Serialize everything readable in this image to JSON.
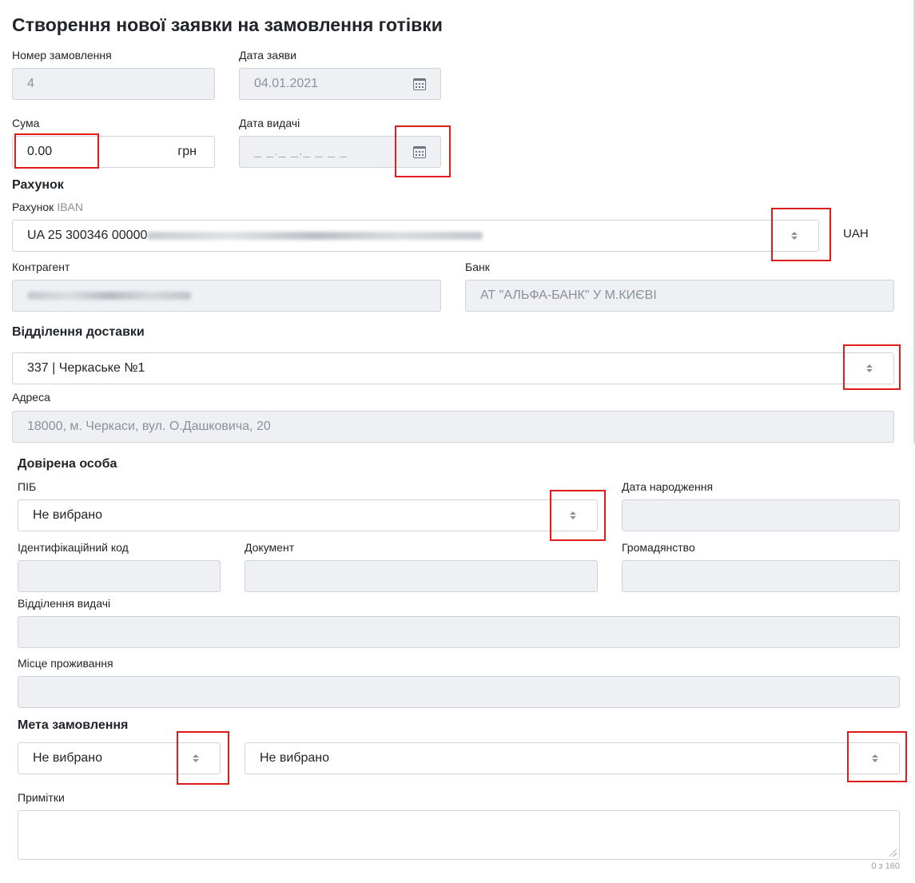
{
  "page": {
    "title": "Створення нової заявки на замовлення готівки"
  },
  "order": {
    "number_label": "Номер замовлення",
    "number_value": "4",
    "request_date_label": "Дата заяви",
    "request_date_value": "04.01.2021",
    "amount_label": "Сума",
    "amount_value": "0.00",
    "amount_currency": "грн",
    "issue_date_label": "Дата видачі",
    "issue_date_placeholder": "_ _._ _._ _ _ _"
  },
  "account": {
    "section_title": "Рахунок",
    "label": "Рахунок",
    "label_hint": "IBAN",
    "iban_visible": "UA 25 300346 00000",
    "currency": "UAH",
    "counterparty_label": "Контрагент",
    "bank_label": "Банк",
    "bank_value": "АТ \"АЛЬФА-БАНК\" У М.КИЄВІ"
  },
  "delivery": {
    "section_title": "Відділення доставки",
    "branch_value": "337 | Черкаське №1",
    "address_label": "Адреса",
    "address_value": "18000, м. Черкаси, вул. О.Дашковича, 20"
  },
  "trusted_person": {
    "section_title": "Довірена особа",
    "name_label": "ПІБ",
    "name_value": "Не вибрано",
    "birth_date_label": "Дата народження",
    "tax_id_label": "Ідентифікаційний код",
    "document_label": "Документ",
    "citizenship_label": "Громадянство",
    "issuing_office_label": "Відділення видачі",
    "residence_label": "Місце проживання"
  },
  "purpose": {
    "section_title": "Мета замовлення",
    "primary_value": "Не вибрано",
    "secondary_value": "Не вибрано"
  },
  "notes": {
    "label": "Примітки",
    "counter": "0 з 160"
  },
  "colors": {
    "highlight": "#e01b1b",
    "readonly_bg": "#eef0f3",
    "border": "#ced4da"
  },
  "icons": {
    "date": "calendar-icon",
    "select": "sort-arrows-icon",
    "resize": "resize-grip-icon"
  }
}
